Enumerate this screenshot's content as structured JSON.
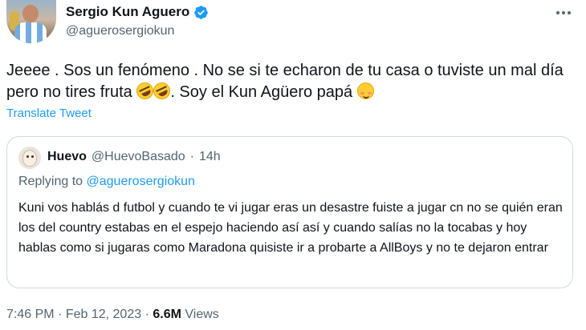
{
  "author": {
    "display_name": "Sergio Kun Aguero",
    "handle": "@aguerosergiokun",
    "verified": true,
    "avatar_icon": "profile-photo"
  },
  "tweet": {
    "text_part1": "Jeeee . Sos un fenómeno . No se si te echaron de tu casa o tuviste un mal día pero no tires fruta ",
    "emoji1": "rolling-on-floor-laughing",
    "emoji2": "rolling-on-floor-laughing",
    "text_part2": ". Soy el Kun Agüero papá ",
    "emoji3": "smiling-face-with-blush",
    "translate_label": "Translate Tweet"
  },
  "quoted": {
    "display_name": "Huevo",
    "handle": "@HuevoBasado",
    "separator": "·",
    "time": "14h",
    "replying_prefix": "Replying to ",
    "replying_to": "@aguerosergiokun",
    "text": "Kuni vos hablás d futbol y cuando te vi jugar eras un desastre fuiste a jugar cn no se quién eran los del country estabas en el espejo haciendo así así y cuando salías no la tocabas y hoy hablas como si jugaras como Maradona quisiste ir a probarte a AllBoys y no te dejaron entrar"
  },
  "footer": {
    "time": "7:46 PM",
    "sep1": "·",
    "date": "Feb 12, 2023",
    "sep2": "·",
    "views_count": "6.6M",
    "views_label": "Views"
  },
  "colors": {
    "link": "#1d9bf0",
    "secondary_text": "#536471",
    "border": "#cfd9de"
  }
}
